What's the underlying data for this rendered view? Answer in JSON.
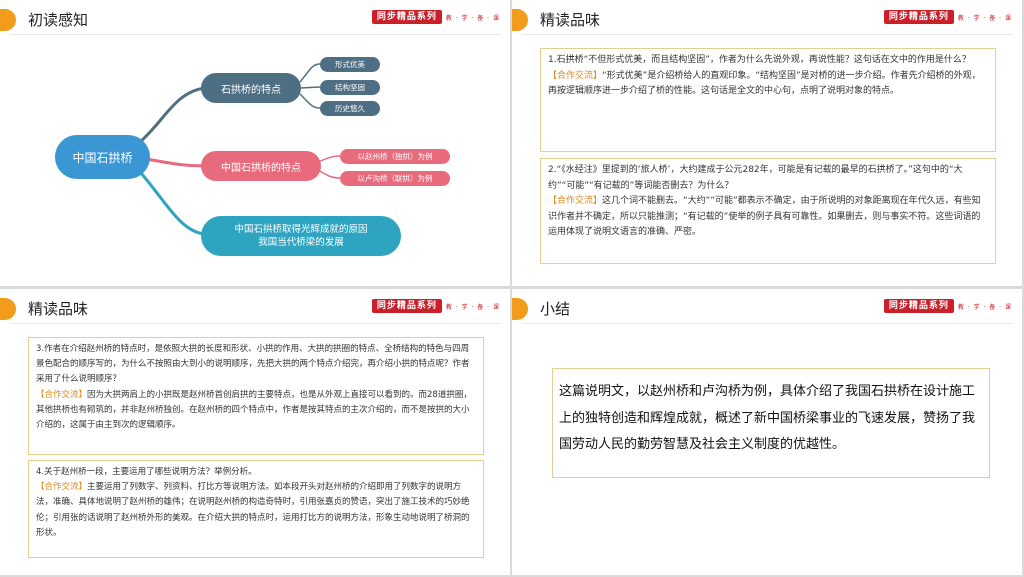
{
  "brand": {
    "label": "同步精品系列",
    "sub": "教 · 学 · 备 · 课"
  },
  "slide1": {
    "title": "初读感知",
    "mindmap": {
      "center": "中国石拱桥",
      "branches": [
        {
          "label": "石拱桥的特点",
          "leaves": [
            "形式优美",
            "结构坚固",
            "历史悠久"
          ]
        },
        {
          "label": "中国石拱桥的特点",
          "leaves": [
            "以赵州桥（独拱）为例",
            "以卢沟桥（联拱）为例"
          ]
        },
        {
          "label_line1": "中国石拱桥取得光辉成就的原因",
          "label_line2": "我国当代桥梁的发展"
        }
      ]
    },
    "colors": {
      "center": "#3b97d3",
      "branch1": "#4e6f83",
      "branch2": "#e86b7d",
      "branch3": "#2ea4c0"
    }
  },
  "slide2": {
    "title": "精读品味",
    "q1": {
      "question": "1.石拱桥“不但形式优美，而且结构坚固”，作者为什么先说外观，再说性能？这句话在文中的作用是什么？",
      "tag": "【合作交流】",
      "answer": "“形式优美”是介绍桥给人的直观印象。“结构坚固”是对桥的进一步介绍。作者先介绍桥的外观，再按逻辑顺序进一步介绍了桥的性能。这句话是全文的中心句，点明了说明对象的特点。"
    },
    "q2": {
      "question": "2.“《水经注》里提到的‘旅人桥’，大约建成于公元282年，可能是有记载的最早的石拱桥了。”这句中的“大约”“可能”“有记载的”等词能否删去？为什么？",
      "tag": "【合作交流】",
      "answer": "这几个词不能删去。“大约”“可能”都表示不确定，由于所说明的对象距离现在年代久远，有些知识作者并不确定，所以只能推测；“有记载的”使举的例子具有可靠性。如果删去，则与事实不符。这些词语的运用体现了说明文语言的准确、严密。"
    }
  },
  "slide3": {
    "title": "精读品味",
    "q3": {
      "question": "3.作者在介绍赵州桥的特点时，是依照大拱的长度和形状、小拱的作用、大拱的拱圈的特点、全桥结构的特色与四周景色配合的顺序写的，为什么不按照由大到小的说明顺序，先把大拱的两个特点介绍完，再介绍小拱的特点呢？作者采用了什么说明顺序？",
      "tag": "【合作交流】",
      "answer": "因为大拱两肩上的小拱既是赵州桥首创肩拱的主要特点，也是从外观上直接可以看到的。而28道拱圈，其他拱桥也有砌筑的，并非赵州桥独创。在赵州桥的四个特点中，作者是按其特点的主次介绍的，而不是按拱的大小介绍的，这属于由主到次的逻辑顺序。"
    },
    "q4": {
      "question": "4.关于赵州桥一段，主要运用了哪些说明方法？举例分析。",
      "tag": "【合作交流】",
      "answer": "主要运用了列数字、列资料、打比方等说明方法。如本段开头对赵州桥的介绍即用了列数字的说明方法，准确、具体地说明了赵州桥的雄伟；在说明赵州桥的构造奇特时，引用张嘉贞的赞语，突出了施工技术的巧妙绝伦；引用张的话说明了赵州桥外形的美观。在介绍大拱的特点时，运用打比方的说明方法，形象生动地说明了桥洞的形状。"
    }
  },
  "slide4": {
    "title": "小结",
    "summary": "这篇说明文，以赵州桥和卢沟桥为例，具体介绍了我国石拱桥在设计施工上的独特创造和辉煌成就，概述了新中国桥梁事业的飞速发展，赞扬了我国劳动人民的勤劳智慧及社会主义制度的优越性。"
  }
}
